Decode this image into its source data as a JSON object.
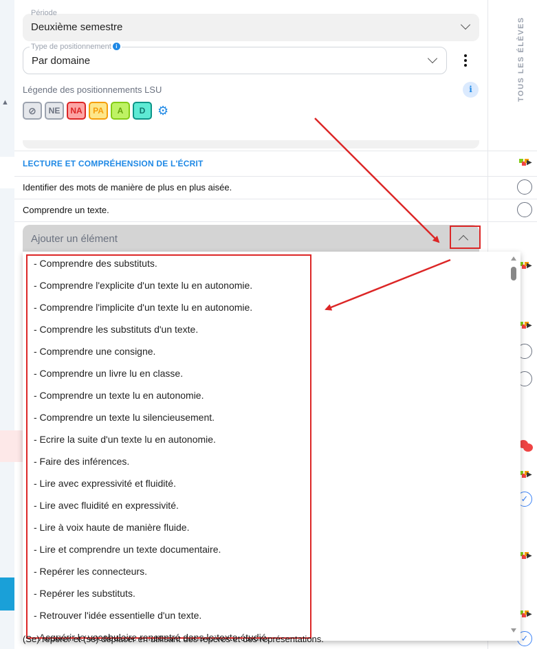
{
  "form": {
    "period_label": "Période",
    "period_value": "Deuxième semestre",
    "type_label": "Type de positionnement",
    "type_info": "i",
    "type_value": "Par domaine",
    "legend_label": "Légende des positionnements LSU",
    "info_label": "i",
    "badges": [
      "NE",
      "NA",
      "PA",
      "A",
      "D"
    ]
  },
  "right_column": {
    "header": "TOUS LES ÉLÈVES"
  },
  "section": {
    "title": "LECTURE ET COMPRÉHENSION DE L'ÉCRIT",
    "rows": [
      "Identifier des mots de manière de plus en plus aisée.",
      "Comprendre un texte."
    ]
  },
  "add_element": {
    "placeholder": "Ajouter un élément"
  },
  "dropdown": {
    "items": [
      "- Comprendre des substituts.",
      "- Comprendre l'explicite d'un texte lu en autonomie.",
      "- Comprendre l'implicite d'un texte lu en autonomie.",
      "- Comprendre les substituts d'un texte.",
      "- Comprendre une consigne.",
      "- Comprendre un livre lu en classe.",
      "- Comprendre un texte lu en autonomie.",
      "- Comprendre un texte lu silencieusement.",
      "- Ecrire la suite d'un texte lu en autonomie.",
      "- Faire des inférences.",
      "- Lire avec expressivité et fluidité.",
      "- Lire avec fluidité en expressivité.",
      "- Lire à voix haute de manière fluide.",
      "- Lire et comprendre un texte documentaire.",
      "- Repérer les connecteurs.",
      "- Repérer les substituts.",
      "- Retrouver l'idée essentielle d'un texte.",
      "- Acquérir le vocabulaire rencontré dans le texte étudié."
    ]
  },
  "bottom_row": "(Se) repérer et (se) déplacer en utilisant des repères et des représentations.",
  "colors": {
    "accent": "#1e88e5",
    "annotation": "#dc2626"
  },
  "icons": [
    "eye-off-icon",
    "gear-icon",
    "kebab-menu-icon",
    "info-icon",
    "chevron-down-icon",
    "chevron-up-icon",
    "export-icon",
    "circle-icon",
    "check-circle-icon",
    "chat-icon"
  ]
}
